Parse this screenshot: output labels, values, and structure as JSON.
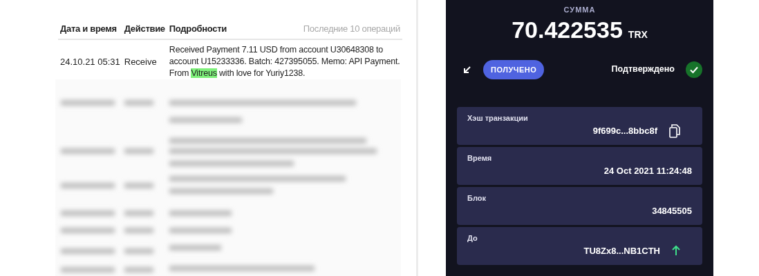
{
  "history": {
    "columns": [
      "Дата и время",
      "Действие",
      "Подробности"
    ],
    "caption": "Последние 10 операций",
    "rows": [
      {
        "date": "24.10.21 05:31",
        "action": "Receive",
        "details": "Received Payment 7.11 USD from account U30648308 to account U15233336. Batch: 427395055. Memo: API Payment. From ",
        "details_highlight": "Vitreus",
        "details_end": " with love for Yuriy1238."
      }
    ],
    "blurred": true
  },
  "transaction": {
    "amount_label": "СУММА",
    "amount": "70.422535",
    "currency": "TRX",
    "status_badge": "ПОЛУЧЕНО",
    "status_text": "Подтверждено",
    "confirmed": true,
    "fields": [
      {
        "label": "Хэш транзакции",
        "value": "9f699c...8bbc8f",
        "kind": "copyable"
      },
      {
        "label": "Время",
        "value": "24 Oct 2021 11:24:48",
        "kind": "plain"
      },
      {
        "label": "Блок",
        "value": "34845505",
        "kind": "plain"
      },
      {
        "label": "До",
        "value": "TU8Zx8...NB1CTH",
        "kind": "address"
      }
    ]
  }
}
